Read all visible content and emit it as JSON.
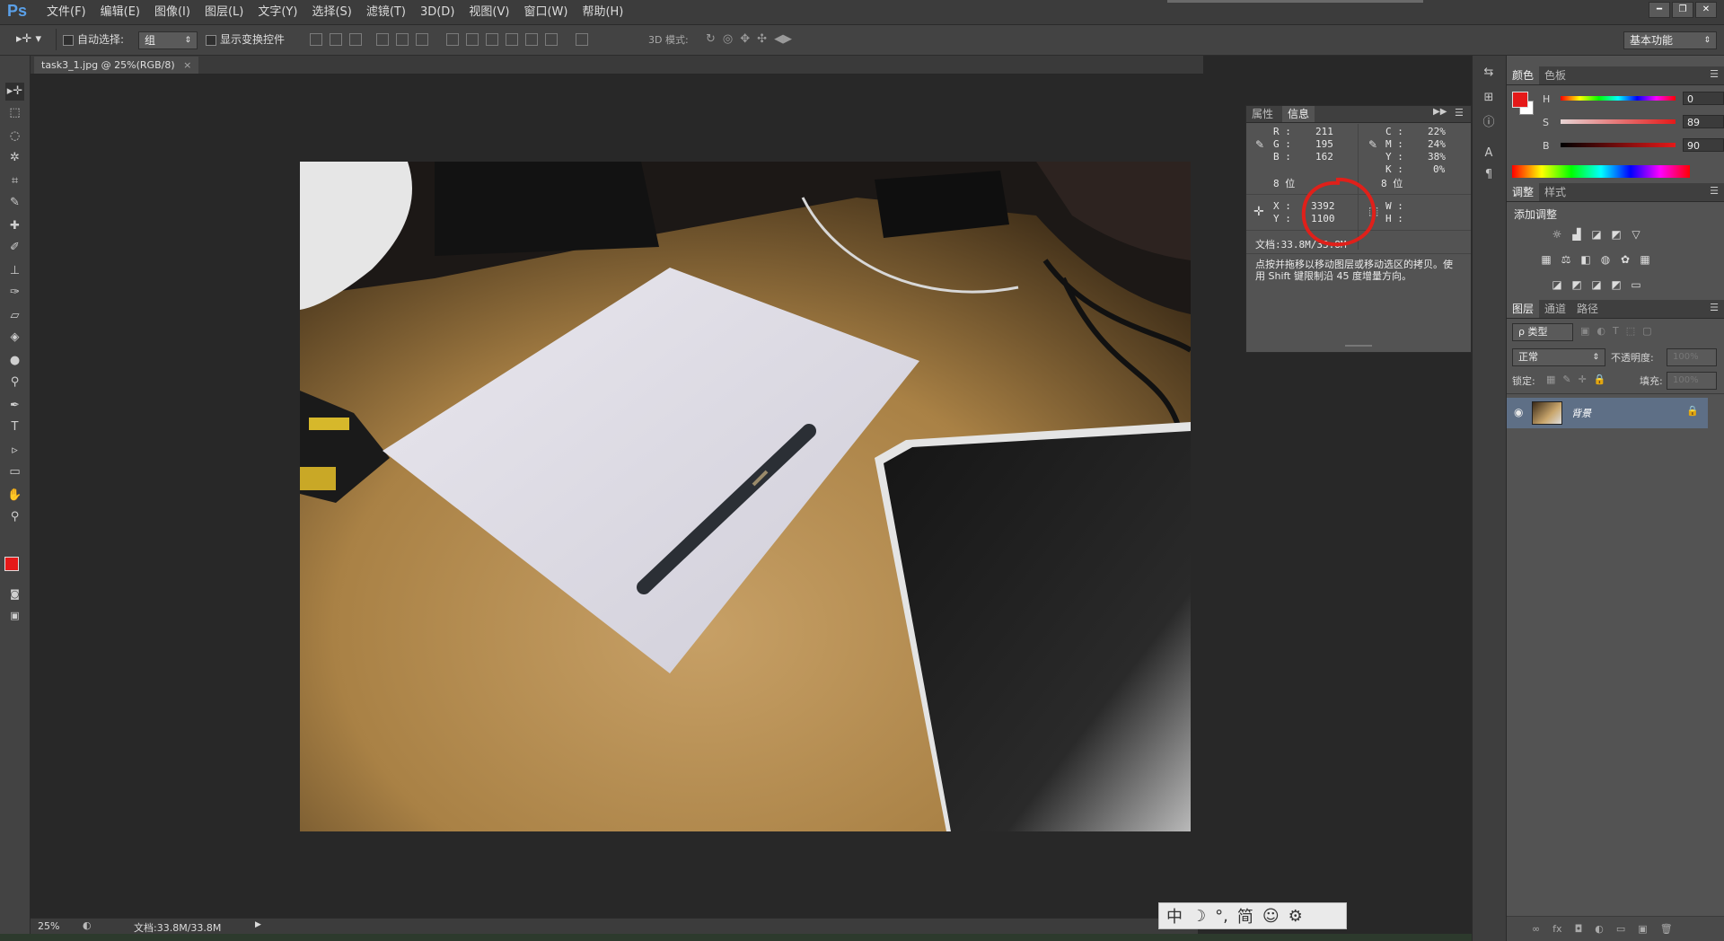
{
  "app": {
    "logo": "Ps"
  },
  "menu": [
    "文件(F)",
    "编辑(E)",
    "图像(I)",
    "图层(L)",
    "文字(Y)",
    "选择(S)",
    "滤镜(T)",
    "3D(D)",
    "视图(V)",
    "窗口(W)",
    "帮助(H)"
  ],
  "options": {
    "auto_select_label": "自动选择:",
    "auto_select_value": "组",
    "show_transform_label": "显示变换控件",
    "mode_3d_label": "3D 模式:",
    "workspace": "基本功能"
  },
  "document": {
    "tab_title": "task3_1.jpg @ 25%(RGB/8)"
  },
  "status": {
    "zoom": "25%",
    "doc_size": "文档:33.8M/33.8M"
  },
  "info_panel": {
    "tabs": [
      "属性",
      "信息"
    ],
    "active_tab": "信息",
    "rgb": {
      "r_label": "R :",
      "r": "211",
      "g_label": "G :",
      "g": "195",
      "b_label": "B :",
      "b": "162",
      "bits": "8 位"
    },
    "cmyk": {
      "c_label": "C :",
      "c": "22%",
      "m_label": "M :",
      "m": "24%",
      "y_label": "Y :",
      "y": "38%",
      "k_label": "K :",
      "k": "0%",
      "bits": "8 位"
    },
    "xy": {
      "x_label": "X :",
      "x": "3392",
      "y_label": "Y :",
      "y": "1100"
    },
    "wh": {
      "w_label": "W :",
      "h_label": "H :"
    },
    "doc": "文档:33.8M/33.8M",
    "hint": "点按并拖移以移动图层或移动选区的拷贝。使用 Shift 键限制沿 45 度增量方向。",
    "annotation_color": "#e0201a"
  },
  "color_panel": {
    "tabs": [
      "颜色",
      "色板"
    ],
    "h_label": "H",
    "h": "0",
    "h_unit": "°",
    "s_label": "S",
    "s": "89",
    "s_unit": "%",
    "b_label": "B",
    "b": "90",
    "b_unit": "%",
    "foreground": "#e51919",
    "background": "#ffffff"
  },
  "adjust_panel": {
    "tabs": [
      "调整",
      "样式"
    ],
    "add_label": "添加调整"
  },
  "layers_panel": {
    "tabs": [
      "图层",
      "通道",
      "路径"
    ],
    "filter_label": "ρ 类型",
    "blend_mode": "正常",
    "opacity_label": "不透明度:",
    "opacity": "100%",
    "lock_label": "锁定:",
    "fill_label": "填充:",
    "fill": "100%",
    "layers": [
      {
        "name": "背景"
      }
    ]
  },
  "ime": {
    "items": [
      "中",
      "☽",
      "°,",
      "简",
      "☺",
      "⚙"
    ]
  }
}
